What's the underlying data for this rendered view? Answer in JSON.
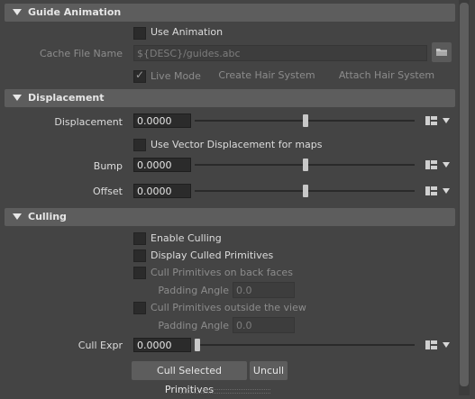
{
  "guide_animation": {
    "title": "Guide Animation",
    "use_animation_label": "Use Animation",
    "cache_file_label": "Cache File Name",
    "cache_file_value": "${DESC}/guides.abc",
    "live_mode_label": "Live Mode",
    "create_hair_label": "Create Hair System",
    "attach_hair_label": "Attach Hair System"
  },
  "displacement": {
    "title": "Displacement",
    "displacement_label": "Displacement",
    "displacement_value": "0.0000",
    "vector_label": "Use Vector Displacement for maps",
    "bump_label": "Bump",
    "bump_value": "0.0000",
    "offset_label": "Offset",
    "offset_value": "0.0000"
  },
  "culling": {
    "title": "Culling",
    "enable_label": "Enable Culling",
    "display_label": "Display Culled Primitives",
    "back_faces_label": "Cull Primitives on back faces",
    "padding_label_1": "Padding Angle",
    "padding_value_1": "0.0",
    "outside_view_label": "Cull Primitives outside the view",
    "padding_label_2": "Padding Angle",
    "padding_value_2": "0.0",
    "cull_expr_label": "Cull Expr",
    "cull_expr_value": "0.0000",
    "cull_selected_label": "Cull Selected Primitives",
    "uncull_label": "Uncull"
  },
  "icons": [
    "collapse-triangle-icon",
    "folder-icon",
    "map-icon",
    "dropdown-arrow-icon",
    "checkmark-icon"
  ],
  "colors": {
    "background": "#444444",
    "header": "#5d5d5d",
    "field": "#2b2b2b"
  }
}
